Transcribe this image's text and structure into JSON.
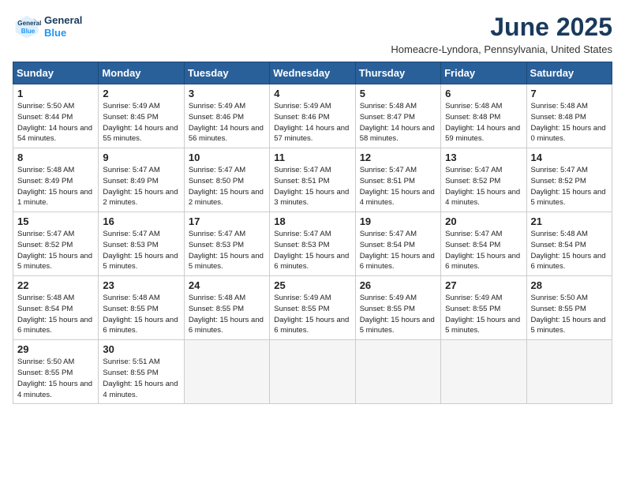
{
  "header": {
    "logo_line1": "General",
    "logo_line2": "Blue",
    "month": "June 2025",
    "location": "Homeacre-Lyndora, Pennsylvania, United States"
  },
  "weekdays": [
    "Sunday",
    "Monday",
    "Tuesday",
    "Wednesday",
    "Thursday",
    "Friday",
    "Saturday"
  ],
  "weeks": [
    [
      {
        "day": "1",
        "sunrise": "5:50 AM",
        "sunset": "8:44 PM",
        "daylight": "14 hours and 54 minutes."
      },
      {
        "day": "2",
        "sunrise": "5:49 AM",
        "sunset": "8:45 PM",
        "daylight": "14 hours and 55 minutes."
      },
      {
        "day": "3",
        "sunrise": "5:49 AM",
        "sunset": "8:46 PM",
        "daylight": "14 hours and 56 minutes."
      },
      {
        "day": "4",
        "sunrise": "5:49 AM",
        "sunset": "8:46 PM",
        "daylight": "14 hours and 57 minutes."
      },
      {
        "day": "5",
        "sunrise": "5:48 AM",
        "sunset": "8:47 PM",
        "daylight": "14 hours and 58 minutes."
      },
      {
        "day": "6",
        "sunrise": "5:48 AM",
        "sunset": "8:48 PM",
        "daylight": "14 hours and 59 minutes."
      },
      {
        "day": "7",
        "sunrise": "5:48 AM",
        "sunset": "8:48 PM",
        "daylight": "15 hours and 0 minutes."
      }
    ],
    [
      {
        "day": "8",
        "sunrise": "5:48 AM",
        "sunset": "8:49 PM",
        "daylight": "15 hours and 1 minute."
      },
      {
        "day": "9",
        "sunrise": "5:47 AM",
        "sunset": "8:49 PM",
        "daylight": "15 hours and 2 minutes."
      },
      {
        "day": "10",
        "sunrise": "5:47 AM",
        "sunset": "8:50 PM",
        "daylight": "15 hours and 2 minutes."
      },
      {
        "day": "11",
        "sunrise": "5:47 AM",
        "sunset": "8:51 PM",
        "daylight": "15 hours and 3 minutes."
      },
      {
        "day": "12",
        "sunrise": "5:47 AM",
        "sunset": "8:51 PM",
        "daylight": "15 hours and 4 minutes."
      },
      {
        "day": "13",
        "sunrise": "5:47 AM",
        "sunset": "8:52 PM",
        "daylight": "15 hours and 4 minutes."
      },
      {
        "day": "14",
        "sunrise": "5:47 AM",
        "sunset": "8:52 PM",
        "daylight": "15 hours and 5 minutes."
      }
    ],
    [
      {
        "day": "15",
        "sunrise": "5:47 AM",
        "sunset": "8:52 PM",
        "daylight": "15 hours and 5 minutes."
      },
      {
        "day": "16",
        "sunrise": "5:47 AM",
        "sunset": "8:53 PM",
        "daylight": "15 hours and 5 minutes."
      },
      {
        "day": "17",
        "sunrise": "5:47 AM",
        "sunset": "8:53 PM",
        "daylight": "15 hours and 5 minutes."
      },
      {
        "day": "18",
        "sunrise": "5:47 AM",
        "sunset": "8:53 PM",
        "daylight": "15 hours and 6 minutes."
      },
      {
        "day": "19",
        "sunrise": "5:47 AM",
        "sunset": "8:54 PM",
        "daylight": "15 hours and 6 minutes."
      },
      {
        "day": "20",
        "sunrise": "5:47 AM",
        "sunset": "8:54 PM",
        "daylight": "15 hours and 6 minutes."
      },
      {
        "day": "21",
        "sunrise": "5:48 AM",
        "sunset": "8:54 PM",
        "daylight": "15 hours and 6 minutes."
      }
    ],
    [
      {
        "day": "22",
        "sunrise": "5:48 AM",
        "sunset": "8:54 PM",
        "daylight": "15 hours and 6 minutes."
      },
      {
        "day": "23",
        "sunrise": "5:48 AM",
        "sunset": "8:55 PM",
        "daylight": "15 hours and 6 minutes."
      },
      {
        "day": "24",
        "sunrise": "5:48 AM",
        "sunset": "8:55 PM",
        "daylight": "15 hours and 6 minutes."
      },
      {
        "day": "25",
        "sunrise": "5:49 AM",
        "sunset": "8:55 PM",
        "daylight": "15 hours and 6 minutes."
      },
      {
        "day": "26",
        "sunrise": "5:49 AM",
        "sunset": "8:55 PM",
        "daylight": "15 hours and 5 minutes."
      },
      {
        "day": "27",
        "sunrise": "5:49 AM",
        "sunset": "8:55 PM",
        "daylight": "15 hours and 5 minutes."
      },
      {
        "day": "28",
        "sunrise": "5:50 AM",
        "sunset": "8:55 PM",
        "daylight": "15 hours and 5 minutes."
      }
    ],
    [
      {
        "day": "29",
        "sunrise": "5:50 AM",
        "sunset": "8:55 PM",
        "daylight": "15 hours and 4 minutes."
      },
      {
        "day": "30",
        "sunrise": "5:51 AM",
        "sunset": "8:55 PM",
        "daylight": "15 hours and 4 minutes."
      },
      null,
      null,
      null,
      null,
      null
    ]
  ]
}
